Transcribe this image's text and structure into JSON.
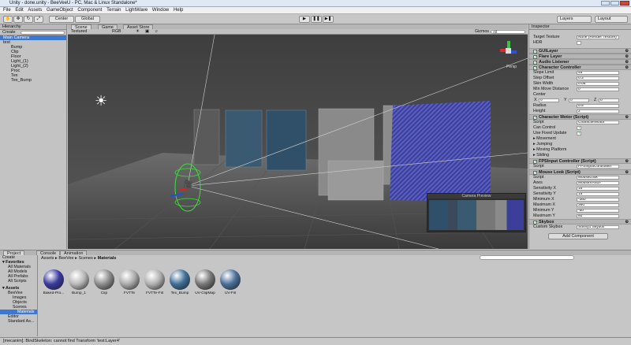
{
  "window": {
    "title": "Unity - done.unity - BeeVeeU - PC, Mac & Linux Standalone*"
  },
  "menu": [
    "File",
    "Edit",
    "Assets",
    "GameObject",
    "Component",
    "Terrain",
    "LightWave",
    "Window",
    "Help"
  ],
  "toolbar": {
    "pivot": "Center",
    "space": "Global",
    "layers": "Layers",
    "layout": "Layout",
    "play": "▶",
    "pause": "❚❚",
    "step": "▶❚"
  },
  "hierarchy": {
    "tab": "Hierarchy",
    "create": "Create",
    "items": [
      {
        "label": "Main Camera",
        "selected": true,
        "indent": 0
      },
      {
        "label": "test",
        "selected": false,
        "indent": 0
      },
      {
        "label": "Bump",
        "selected": false,
        "indent": 1
      },
      {
        "label": "Clip",
        "selected": false,
        "indent": 1
      },
      {
        "label": "Floor",
        "selected": false,
        "indent": 1
      },
      {
        "label": "Light_(1)",
        "selected": false,
        "indent": 1
      },
      {
        "label": "Light_(2)",
        "selected": false,
        "indent": 1
      },
      {
        "label": "Proc",
        "selected": false,
        "indent": 1
      },
      {
        "label": "Tex",
        "selected": false,
        "indent": 1
      },
      {
        "label": "Tex_Bump",
        "selected": false,
        "indent": 1
      }
    ]
  },
  "scene": {
    "tabs": [
      "Scene",
      "Game",
      "Asset Store"
    ],
    "shading": "Textured",
    "render": "RGB",
    "gizmos": "Gizmos",
    "search": "All",
    "persp": "Persp",
    "camera_preview": "Camera Preview"
  },
  "inspector": {
    "tab": "Inspector",
    "rows_top": [
      {
        "label": "Target Texture",
        "value": "None (Render Texture)"
      },
      {
        "label": "HDR",
        "value": ""
      }
    ],
    "gui_layer": "GUILayer",
    "flare_layer": "Flare Layer",
    "audio_listener": "Audio Listener",
    "character_controller": {
      "title": "Character Controller",
      "rows": [
        {
          "label": "Slope Limit",
          "value": "45"
        },
        {
          "label": "Step Offset",
          "value": "0.3"
        },
        {
          "label": "Skin Width",
          "value": "0.08"
        },
        {
          "label": "Min Move Distance",
          "value": "0"
        }
      ],
      "center": "Center",
      "cx": "0",
      "cy": "0",
      "cz": "0",
      "radius": {
        "label": "Radius",
        "value": "0.5"
      },
      "height": {
        "label": "Height",
        "value": "2"
      }
    },
    "character_motor": {
      "title": "Character Motor (Script)",
      "script": {
        "label": "Script",
        "value": "CharacterMotor"
      },
      "can_control": "Can Control",
      "use_fixed_update": "Use Fixed Update",
      "foldouts": [
        "Movement",
        "Jumping",
        "Moving Platform",
        "Sliding"
      ]
    },
    "fps_input": {
      "title": "FPSInput Controller (Script)",
      "script": {
        "label": "Script",
        "value": "FPSInputControllerr"
      }
    },
    "mouse_look": {
      "title": "Mouse Look (Script)",
      "rows": [
        {
          "label": "Script",
          "value": "MouseLook"
        },
        {
          "label": "Axes",
          "value": "MouseXAndY"
        },
        {
          "label": "Sensitivity X",
          "value": "15"
        },
        {
          "label": "Sensitivity Y",
          "value": "15"
        },
        {
          "label": "Minimum X",
          "value": "-360"
        },
        {
          "label": "Maximum X",
          "value": "360"
        },
        {
          "label": "Minimum Y",
          "value": "-60"
        },
        {
          "label": "Maximum Y",
          "value": "60"
        }
      ]
    },
    "skybox": {
      "title": "Skybox",
      "custom": {
        "label": "Custom Skybox",
        "value": "Sunny1 Skybox"
      }
    },
    "add_component": "Add Component"
  },
  "bottom": {
    "tabs": [
      "Project",
      "Console",
      "Animation"
    ],
    "create": "Create",
    "favorites": {
      "title": "Favorites",
      "items": [
        "All Materials",
        "All Models",
        "All Prefabs",
        "All Scripts"
      ]
    },
    "assets": {
      "title": "Assets",
      "items": [
        "BeeVee",
        "Images",
        "Objects",
        "Scenes",
        "Materials",
        "Editor",
        "Standard As..."
      ]
    },
    "breadcrumb": [
      "Assets",
      "BeeVee",
      "Scenes",
      "Materials"
    ],
    "materials": [
      {
        "label": "Baked-Pro...",
        "color": "#3a3aa0"
      },
      {
        "label": "Bump_1",
        "color": "#b8b8b8"
      },
      {
        "label": "Clip",
        "color": "#8c8c8c"
      },
      {
        "label": "FVTTe",
        "color": "#aaaaaa"
      },
      {
        "label": "FVTTe-Fill",
        "color": "#b0b0b0"
      },
      {
        "label": "Tex_Bump",
        "color": "#3f6f98"
      },
      {
        "label": "UV-ClipMap",
        "color": "#777777"
      },
      {
        "label": "UV-Fill",
        "color": "#4a6f9a"
      }
    ]
  },
  "status": {
    "message": "[mecanim]: BindSkeleton: cannot find Transform 'test:Layer4'"
  },
  "colors": {
    "selection": "#3c78d2",
    "scene_bg": "#4a4a4a",
    "panel": "#c3c3c3"
  }
}
